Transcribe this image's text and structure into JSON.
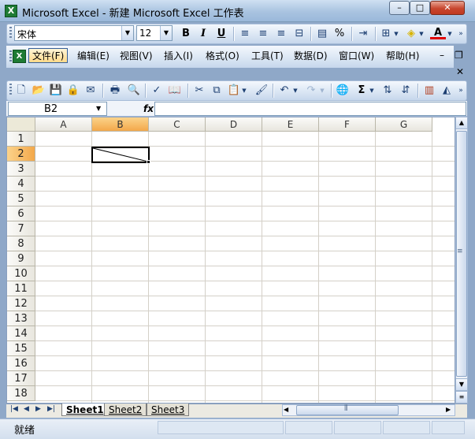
{
  "window": {
    "title": "Microsoft Excel - 新建 Microsoft Excel 工作表",
    "app_icon": "X",
    "minimize_label": "–",
    "maximize_label": "□",
    "close_label": "✕"
  },
  "format_toolbar": {
    "font_name": "宋体",
    "font_size": "12",
    "bold_label": "B",
    "italic_label": "I",
    "underline_label": "U",
    "percent_label": "%",
    "font_color_label": "A"
  },
  "menu": {
    "items": [
      "文件(F)",
      "编辑(E)",
      "视图(V)",
      "插入(I)",
      "格式(O)",
      "工具(T)",
      "数据(D)",
      "窗口(W)",
      "帮助(H)"
    ],
    "active_item": "文件(F)",
    "doc_minimize_label": "–",
    "doc_restore_label": "❐",
    "doc_close_label": "✕",
    "close_label": "✕"
  },
  "standard_toolbar": {
    "sum_label": "Σ"
  },
  "formula_bar": {
    "name_box": "B2",
    "fx_label": "fx",
    "formula": ""
  },
  "grid": {
    "columns": [
      "A",
      "B",
      "C",
      "D",
      "E",
      "F",
      "G"
    ],
    "rows": [
      "1",
      "2",
      "3",
      "4",
      "5",
      "6",
      "7",
      "8",
      "9",
      "10",
      "11",
      "12",
      "13",
      "14",
      "15",
      "16",
      "17",
      "18"
    ],
    "selected_column": "B",
    "selected_row": "2",
    "active_cell": "B2",
    "active_cell_diagonal_border": true
  },
  "sheet_tabs": {
    "tabs": [
      "Sheet1",
      "Sheet2",
      "Sheet3"
    ],
    "active_tab": "Sheet1"
  },
  "status_bar": {
    "status": "就绪"
  },
  "colors": {
    "selected_header": "#f3a84a",
    "titlebar": "#a9c3e0",
    "close_button": "#c8462e"
  }
}
